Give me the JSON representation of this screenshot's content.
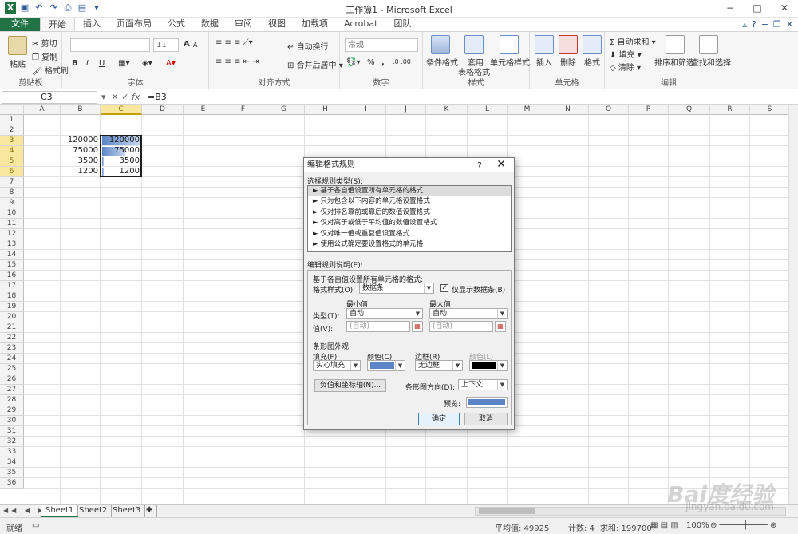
{
  "window": {
    "title": "工作簿1 - Microsoft Excel"
  },
  "tabs": [
    "文件",
    "开始",
    "插入",
    "页面布局",
    "公式",
    "数据",
    "审阅",
    "视图",
    "加载项",
    "Acrobat",
    "团队"
  ],
  "ribbon": {
    "clipboard": {
      "paste": "粘贴",
      "cut": "剪切",
      "copy": "复制",
      "format_painter": "格式刷",
      "label": "剪贴板"
    },
    "font": {
      "size": "11",
      "bold": "B",
      "italic": "I",
      "underline": "U",
      "grow": "A",
      "shrink": "A",
      "label": "字体"
    },
    "align": {
      "wrap": "自动换行",
      "merge": "合并后居中",
      "label": "对齐方式"
    },
    "number": {
      "format": "常规",
      "percent": "%",
      "comma": ",",
      "label": "数字"
    },
    "styles": {
      "cond": "条件格式",
      "table1": "套用",
      "table2": "表格格式",
      "cell": "单元格样式",
      "label": "样式"
    },
    "cells": {
      "insert": "插入",
      "delete": "删除",
      "format": "格式",
      "label": "单元格"
    },
    "edit": {
      "autosum": "自动求和",
      "fill": "填充",
      "clear": "清除",
      "sort": "排序和筛选",
      "find": "查找和选择",
      "label": "编辑"
    }
  },
  "formula_bar": {
    "cell": "C3",
    "fx": "fx",
    "formula": "=B3"
  },
  "columns": [
    "A",
    "B",
    "C",
    "D",
    "E",
    "F",
    "G",
    "H",
    "I",
    "J",
    "K",
    "L",
    "M",
    "N",
    "O",
    "P",
    "Q",
    "R",
    "S"
  ],
  "rows": [
    "1",
    "2",
    "3",
    "4",
    "5",
    "6",
    "7",
    "8",
    "9",
    "10",
    "11",
    "12",
    "13",
    "14",
    "15",
    "16",
    "17",
    "18",
    "19",
    "20",
    "21",
    "22",
    "23",
    "24",
    "25",
    "26",
    "27",
    "28",
    "29",
    "30",
    "31",
    "32",
    "33",
    "34",
    "35",
    "36"
  ],
  "cells": {
    "b3": "120000",
    "b4": "75000",
    "b5": "3500",
    "b6": "1200",
    "c3": "120000",
    "c4": "75000",
    "c5": "3500",
    "c6": "1200"
  },
  "databar_fractions": [
    1.0,
    0.625,
    0.029,
    0.01
  ],
  "sheets": [
    "Sheet1",
    "Sheet2",
    "Sheet3"
  ],
  "status": {
    "mode": "就绪",
    "average": "平均值: 49925",
    "count": "计数: 4",
    "sum": "求和: 199700",
    "zoom": "100%"
  },
  "dialog": {
    "title": "编辑格式规则",
    "help": "?",
    "select_type_label": "选择规则类型(S):",
    "rules": [
      "► 基于各自值设置所有单元格的格式",
      "► 只为包含以下内容的单元格设置格式",
      "► 仅对排名靠前或靠后的数值设置格式",
      "► 仅对高于或低于平均值的数值设置格式",
      "► 仅对唯一值或重复值设置格式",
      "► 使用公式确定要设置格式的单元格"
    ],
    "edit_desc_label": "编辑规则说明(E):",
    "based_on": "基于各自值设置所有单元格的格式:",
    "format_style_label": "格式样式(O):",
    "format_style": "数据条",
    "show_bar_only": "仅显示数据条(B)",
    "min_label": "最小值",
    "max_label": "最大值",
    "type_label": "类型(T):",
    "value_label": "值(V):",
    "min_type": "自动",
    "max_type": "自动",
    "min_value": "(自动)",
    "max_value": "(自动)",
    "bar_appearance": "条形图外观:",
    "fill_label": "填充(F)",
    "fill_value": "实心填充",
    "color_label": "颜色(C)",
    "border_label": "边框(R)",
    "border_value": "无边框",
    "border_color_label": "颜色(L)",
    "neg_axis_button": "负值和坐标轴(N)...",
    "direction_label": "条形图方向(D):",
    "direction_value": "上下文",
    "preview_label": "预览:",
    "ok": "确定",
    "cancel": "取消",
    "bar_color": "#5b85c6"
  }
}
